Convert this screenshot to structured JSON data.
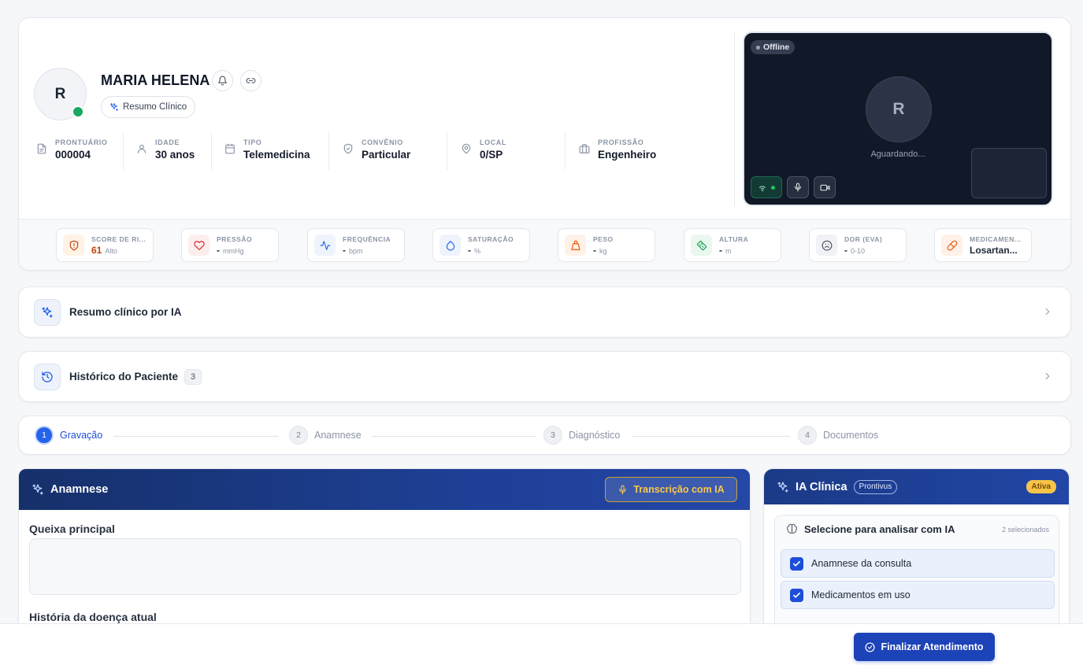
{
  "patient": {
    "avatar_initial": "R",
    "name": "MARIA HELENA",
    "summary_chip": "Resumo Clínico",
    "meta": [
      {
        "label": "PRONTUÁRIO",
        "value": "000004",
        "icon": "document-icon"
      },
      {
        "label": "IDADE",
        "value": "30 anos",
        "icon": "user-icon"
      },
      {
        "label": "TIPO",
        "value": "Telemedicina",
        "icon": "calendar-icon"
      },
      {
        "label": "CONVÊNIO",
        "value": "Particular",
        "icon": "shield-icon"
      },
      {
        "label": "LOCAL",
        "value": "0/SP",
        "icon": "map-pin-icon"
      },
      {
        "label": "PROFISSÃO",
        "value": "Engenheiro",
        "icon": "briefcase-icon"
      }
    ]
  },
  "video": {
    "status": "Offline",
    "avatar_initial": "R",
    "waiting": "Aguardando..."
  },
  "vitals": [
    {
      "label": "SCORE DE RI...",
      "value": "61",
      "unit": "Alto",
      "icon": "shield-alert-icon",
      "accent": "#c2410c"
    },
    {
      "label": "PRESSÃO",
      "value": "-",
      "unit": "mmHg",
      "icon": "heart-icon"
    },
    {
      "label": "FREQUÊNCIA",
      "value": "-",
      "unit": "bpm",
      "icon": "activity-icon"
    },
    {
      "label": "SATURAÇÃO",
      "value": "-",
      "unit": "%",
      "icon": "droplet-icon"
    },
    {
      "label": "PESO",
      "value": "-",
      "unit": "kg",
      "icon": "weight-icon"
    },
    {
      "label": "ALTURA",
      "value": "-",
      "unit": "m",
      "icon": "ruler-icon"
    },
    {
      "label": "DOR (EVA)",
      "value": "-",
      "unit": "0-10",
      "icon": "frown-icon"
    },
    {
      "label": "MEDICAMEN...",
      "value": "Losartan...",
      "unit": "",
      "icon": "pill-icon"
    }
  ],
  "sections": {
    "ai_summary": {
      "title": "Resumo clínico por IA"
    },
    "history": {
      "title": "Histórico do Paciente",
      "count": "3"
    }
  },
  "stepper": [
    {
      "num": "1",
      "label": "Gravação",
      "active": true
    },
    {
      "num": "2",
      "label": "Anamnese",
      "active": false
    },
    {
      "num": "3",
      "label": "Diagnóstico",
      "active": false
    },
    {
      "num": "4",
      "label": "Documentos",
      "active": false
    }
  ],
  "anamnese": {
    "title": "Anamnese",
    "transcription_button": "Transcrição com IA",
    "field1_label": "Queixa principal",
    "field2_label": "História da doença atual"
  },
  "ia": {
    "title": "IA Clínica",
    "badge": "Prontivus",
    "status": "Ativa",
    "select_title": "Selecione para analisar com IA",
    "selected_count": "2 selecionados",
    "options": [
      "Anamnese da consulta",
      "Medicamentos em uso"
    ]
  },
  "footer": {
    "finish_button": "Finalizar Atendimento"
  },
  "colors": {
    "primary": "#1d43b8",
    "online": "#17a861",
    "risk": "#c2410c",
    "warning": "#f7c44a"
  }
}
